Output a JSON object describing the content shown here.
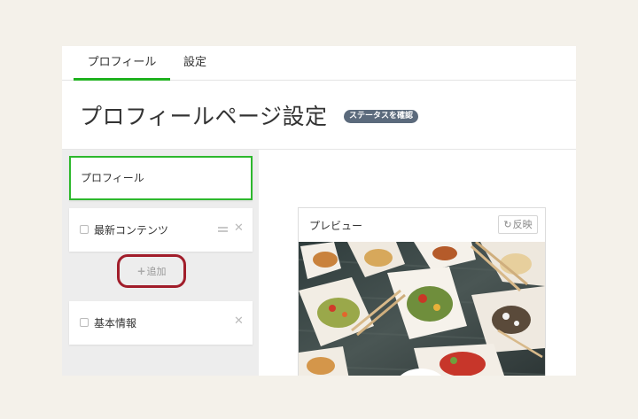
{
  "tabs": [
    {
      "label": "プロフィール",
      "active": true
    },
    {
      "label": "設定",
      "active": false
    }
  ],
  "page": {
    "title": "プロフィールページ設定",
    "status_badge": "ステータスを確認"
  },
  "sidebar": {
    "profile_card": {
      "label": "プロフィール",
      "selected": true
    },
    "items": [
      {
        "label": "最新コンテンツ",
        "checked": false,
        "draggable": true
      },
      {
        "label": "基本情報",
        "checked": false,
        "draggable": false
      }
    ],
    "add_label": "追加"
  },
  "preview": {
    "title": "プレビュー",
    "reflect_label": "反映"
  },
  "icons": {
    "plus": "plus-icon",
    "refresh": "refresh-icon",
    "drag": "drag-handle-icon",
    "close": "close-icon"
  },
  "colors": {
    "accent_green": "#1fb21f",
    "badge_bg": "#5b6a7c",
    "highlight_ring": "#a11d2a",
    "page_bg": "#f4f1ea"
  }
}
